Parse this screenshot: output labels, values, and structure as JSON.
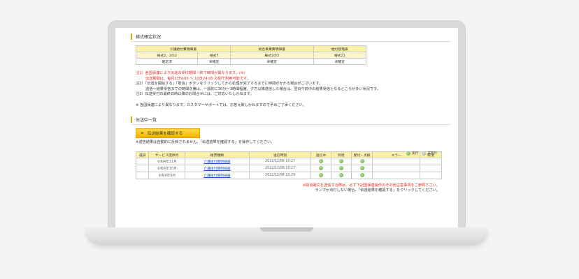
{
  "status_section": {
    "title": "様式確定状況",
    "headers": [
      "介護給付費明細書",
      "総合事業費明細書",
      "給付管理表"
    ],
    "subheaders": [
      "様式2、2の2",
      "様式7",
      "様式2の3",
      "様式11"
    ],
    "values": [
      "確定済",
      "未確定",
      "未確定",
      "未確定"
    ]
  },
  "notes": {
    "n1": "注1）各国保連により伝送の受付期間・終了時間が異なります。(※)",
    "n1b": "伝送期間は、毎月1日9:00 ～ 10日24:00 の間で利用可能です。",
    "n2": "注2）「伝送を開始する」「取消」ボタンをクリックしてから処理が完了するまでに時間がかかる場合がございます。",
    "n2b": "送信～結果受信までの時間次第は、一般的に30分～3時間程度、夕方以降送信した場合は、翌日午前中の結果受信となるところが多い状況です。",
    "n3": "注3）伝送受付の最終日時以降のお問合せには、ご対応いたしかねます。",
    "n4": "※ 各国保連により異なります。カスタマーサポートでは、お答え致しかねますので予めご了承ください。"
  },
  "transmission_section": {
    "title": "伝送中一覧",
    "confirm_button": "伝送結果を確認する",
    "hint": "※送信結果は自動的に反映されません。「伝送結果を確認する」を操作してください。",
    "legend_done": "実行",
    "legend_notdone": "未実行",
    "columns": [
      "選択",
      "サービス提供月",
      "帳票種類",
      "送信時刻",
      "送信中",
      "到達",
      "受付・点検",
      "エラー",
      "取消"
    ],
    "rows": [
      {
        "month": "令和4年11月",
        "type": "介護給付費明細書",
        "time": "2022/12/08 10:27"
      },
      {
        "month": "令和4年10月",
        "type": "介護給付費明細書",
        "time": "2022/12/08 10:27"
      },
      {
        "month": "令和4年9月",
        "type": "介護給付費明細書",
        "time": "2022/12/08 10:29"
      }
    ],
    "footer1": "※取消電文を送信する際は、必ず下記国保連操作のその他注意事項をご参照下さい。",
    "footer2": "ランプが点灯しない場合、「伝送結果を確認する」をクリックしてください。"
  },
  "colors": {
    "accent": "#f0a000",
    "header_yellow": "#fbf1a8",
    "alert_red": "#e32a1f",
    "link_blue": "#1f57c7",
    "lamp_green": "#5e9f3a"
  }
}
